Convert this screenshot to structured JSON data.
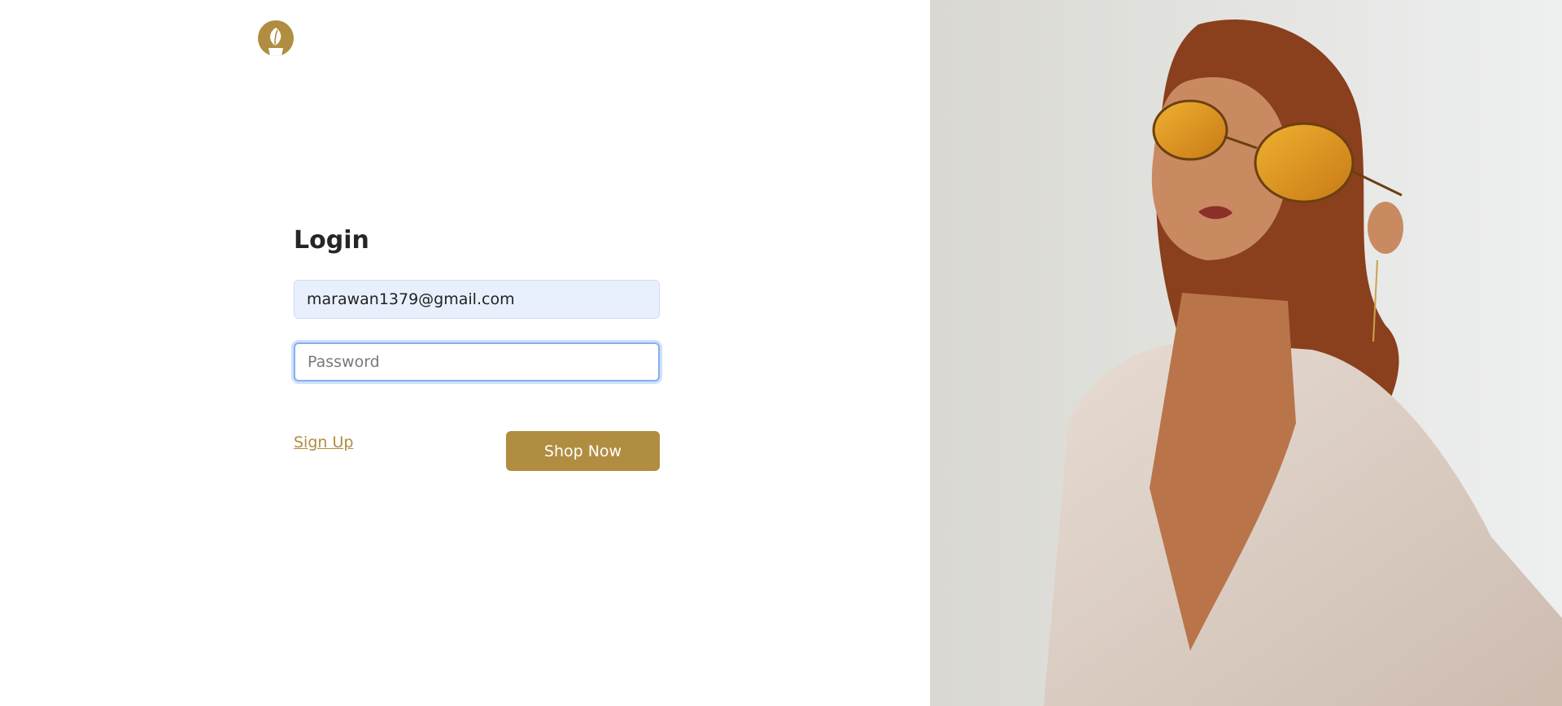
{
  "brand": {
    "logo_icon": "leaf-icon",
    "accent_color": "#b08d40"
  },
  "login": {
    "title": "Login",
    "email_value": "marawan1379@gmail.com",
    "password_placeholder": "Password",
    "signup_label": "Sign Up",
    "submit_label": "Shop Now"
  },
  "hero": {
    "image": "woman-with-amber-sunglasses-photo"
  }
}
